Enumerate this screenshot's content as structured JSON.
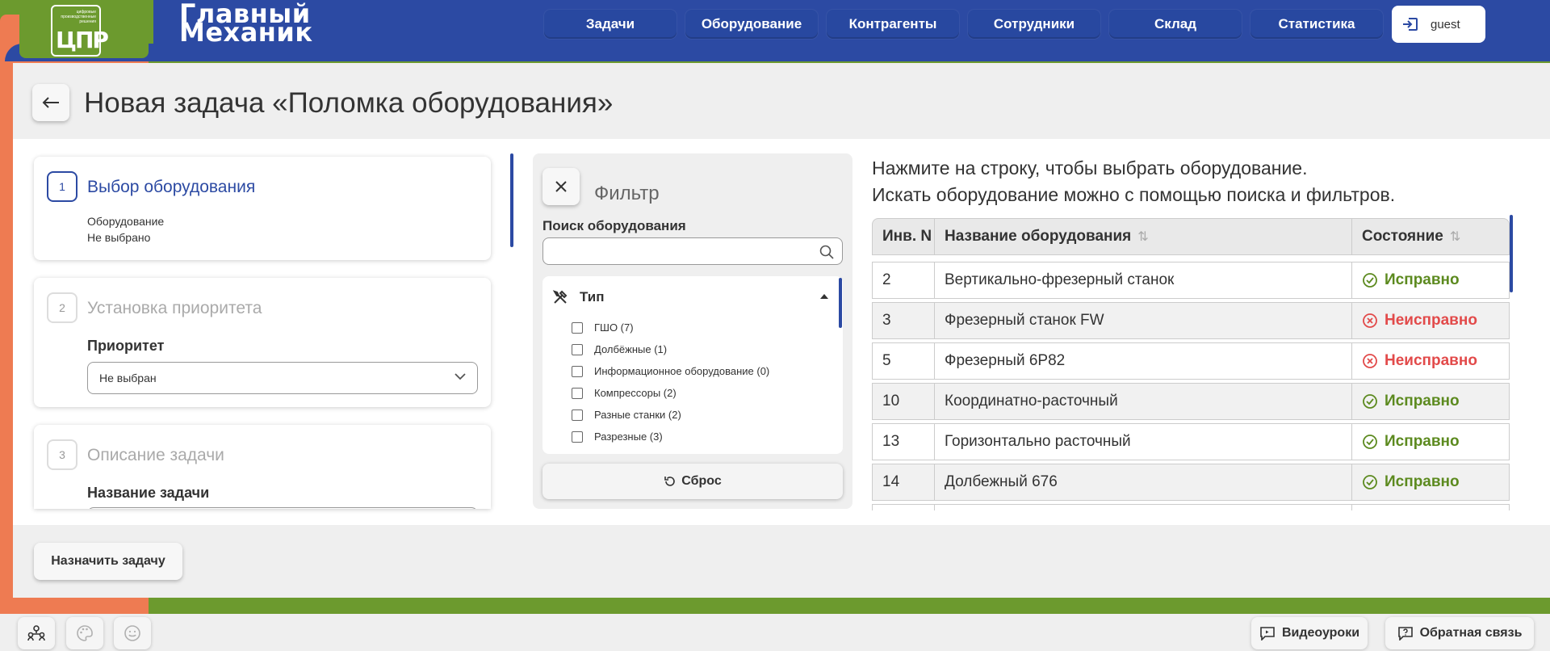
{
  "brand": {
    "logo_tiny": "цифровые производственные решения",
    "logo_mark": "ЦПР",
    "line1": "Главный",
    "line2": "Механик"
  },
  "nav": {
    "items": [
      "Задачи",
      "Оборудование",
      "Контрагенты",
      "Сотрудники",
      "Склад",
      "Статистика"
    ],
    "user": "guest"
  },
  "page": {
    "title": "Новая задача «Поломка оборудования»"
  },
  "steps": {
    "s1": {
      "num": "1",
      "title": "Выбор оборудования",
      "sub1": "Оборудование",
      "sub2": "Не выбрано"
    },
    "s2": {
      "num": "2",
      "title": "Установка приоритета",
      "label": "Приоритет",
      "select_value": "Не выбран"
    },
    "s3": {
      "num": "3",
      "title": "Описание задачи",
      "label": "Название задачи"
    }
  },
  "filter": {
    "title": "Фильтр",
    "search_label": "Поиск оборудования",
    "search_value": "",
    "type_title": "Тип",
    "types": [
      "ГШО (7)",
      "Долбёжные (1)",
      "Информационное оборудование (0)",
      "Компрессоры (2)",
      "Разные станки (2)",
      "Разрезные (3)"
    ],
    "reset": "Сброс"
  },
  "table": {
    "hint1": "Нажмите на строку, чтобы выбрать оборудование.",
    "hint2": "Искать оборудование можно с помощью поиска и фильтров.",
    "col_inv": "Инв. N",
    "col_name": "Название оборудования",
    "col_state": "Состояние",
    "rows": [
      {
        "inv": "2",
        "name": "Вертикально-фрезерный станок",
        "state": "Исправно"
      },
      {
        "inv": "3",
        "name": "Фрезерный станок FW",
        "state": "Неисправно"
      },
      {
        "inv": "5",
        "name": "Фрезерный 6Р82",
        "state": "Неисправно"
      },
      {
        "inv": "10",
        "name": "Координатно-расточный",
        "state": "Исправно"
      },
      {
        "inv": "13",
        "name": "Горизонтально расточный",
        "state": "Исправно"
      },
      {
        "inv": "14",
        "name": "Долбежный 676",
        "state": "Исправно"
      }
    ]
  },
  "actions": {
    "assign": "Назначить задачу",
    "video": "Видеоуроки",
    "feedback": "Обратная связь"
  },
  "colors": {
    "brand_blue": "#2c4aa3",
    "brand_green": "#6c9a2e",
    "brand_orange": "#ee7b52",
    "status_ok": "#5c8a1f",
    "status_bad": "#e24a4a"
  }
}
